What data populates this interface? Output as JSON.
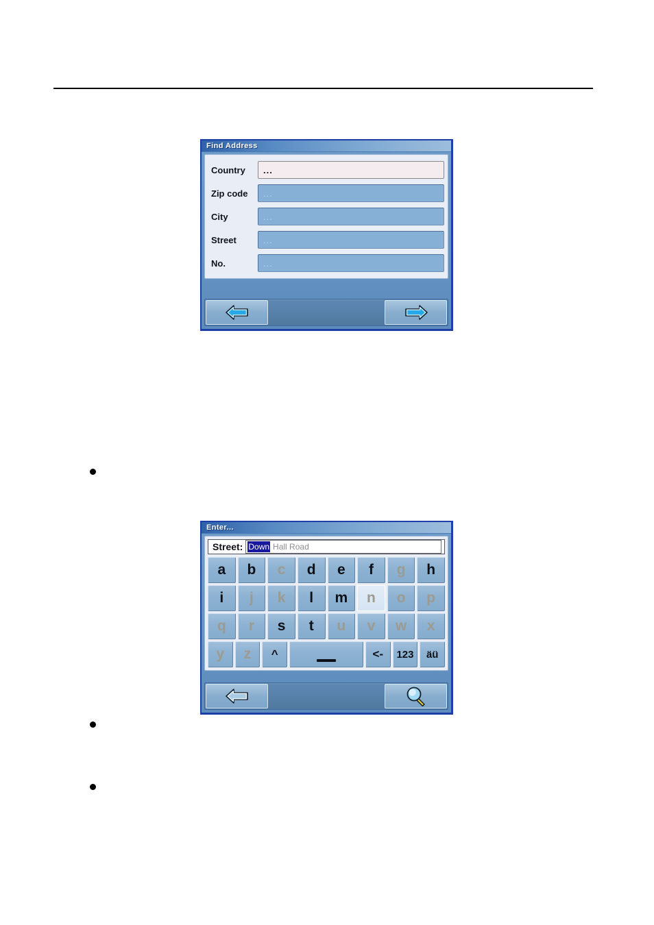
{
  "page": {
    "background": "#ffffff",
    "rule_color": "#000000",
    "bullets": 3
  },
  "dialog_find_address": {
    "title": "Find Address",
    "fields": [
      {
        "label": "Country",
        "value": "...",
        "state": "active",
        "name": "country"
      },
      {
        "label": "Zip code",
        "value": "...",
        "state": "empty",
        "name": "zip-code"
      },
      {
        "label": "City",
        "value": "...",
        "state": "empty",
        "name": "city"
      },
      {
        "label": "Street",
        "value": "...",
        "state": "empty",
        "name": "street"
      },
      {
        "label": "No.",
        "value": "...",
        "state": "empty",
        "name": "house-number"
      }
    ],
    "toolbar": {
      "back_icon": "arrow-left-icon",
      "forward_icon": "arrow-right-icon"
    }
  },
  "dialog_enter": {
    "title": "Enter...",
    "input": {
      "label": "Street:",
      "selected_text": "Down",
      "completion_text": "Hall Road",
      "full_value": "Down Hall Road"
    },
    "keyboard": {
      "rows": [
        [
          {
            "label": "a",
            "state": "enabled"
          },
          {
            "label": "b",
            "state": "enabled"
          },
          {
            "label": "c",
            "state": "disabled"
          },
          {
            "label": "d",
            "state": "enabled"
          },
          {
            "label": "e",
            "state": "enabled"
          },
          {
            "label": "f",
            "state": "enabled"
          },
          {
            "label": "g",
            "state": "disabled"
          },
          {
            "label": "h",
            "state": "enabled"
          }
        ],
        [
          {
            "label": "i",
            "state": "enabled"
          },
          {
            "label": "j",
            "state": "disabled"
          },
          {
            "label": "k",
            "state": "disabled"
          },
          {
            "label": "l",
            "state": "enabled"
          },
          {
            "label": "m",
            "state": "enabled"
          },
          {
            "label": "n",
            "state": "disabled",
            "highlight": true
          },
          {
            "label": "o",
            "state": "disabled"
          },
          {
            "label": "p",
            "state": "disabled"
          }
        ],
        [
          {
            "label": "q",
            "state": "disabled"
          },
          {
            "label": "r",
            "state": "disabled"
          },
          {
            "label": "s",
            "state": "enabled"
          },
          {
            "label": "t",
            "state": "enabled"
          },
          {
            "label": "u",
            "state": "disabled"
          },
          {
            "label": "v",
            "state": "disabled"
          },
          {
            "label": "w",
            "state": "disabled"
          },
          {
            "label": "x",
            "state": "disabled"
          }
        ],
        [
          {
            "label": "y",
            "state": "disabled"
          },
          {
            "label": "z",
            "state": "disabled"
          },
          {
            "label": "^",
            "state": "enabled",
            "key": "shift"
          },
          {
            "label": "",
            "state": "enabled",
            "key": "space",
            "wide": true
          },
          {
            "label": "<-",
            "state": "enabled",
            "key": "backspace",
            "size": "small"
          },
          {
            "label": "123",
            "state": "enabled",
            "key": "numbers",
            "size": "tiny"
          },
          {
            "label": "äü",
            "state": "enabled",
            "key": "accents",
            "size": "tiny"
          }
        ]
      ]
    },
    "toolbar": {
      "back_icon": "arrow-left-icon",
      "search_icon": "magnifier-icon"
    }
  },
  "colors": {
    "titlebar_dark": "#2f62a8",
    "titlebar_light": "#9dbddc",
    "dialog_border": "#1f3fa8",
    "panel_bg": "#e9eef6",
    "field_bg": "#86b0d6",
    "field_active_bg": "#f4ecee",
    "key_bg": "#8db2d2",
    "selection_bg": "#18189c",
    "arrow_fill": "#29a8e8",
    "magnifier_handle": "#f2d23a"
  }
}
